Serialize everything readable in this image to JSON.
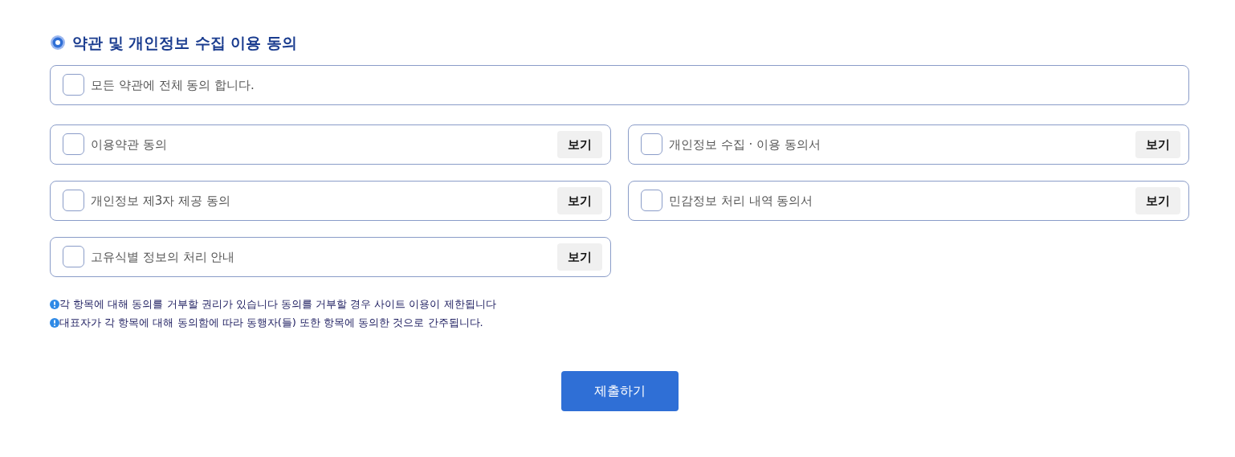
{
  "section": {
    "title": "약관 및 개인정보 수집 이용 동의"
  },
  "agree_all": {
    "label": "모든 약관에 전체 동의 합니다.",
    "checked": false
  },
  "terms": [
    {
      "label": "이용약관 동의",
      "checked": false,
      "view_button": "보기"
    },
    {
      "label": "개인정보 수집 · 이용 동의서",
      "checked": false,
      "view_button": "보기"
    },
    {
      "label": "개인정보 제3자 제공 동의",
      "checked": false,
      "view_button": "보기"
    },
    {
      "label": "민감정보 처리 내역 동의서",
      "checked": false,
      "view_button": "보기"
    },
    {
      "label": "고유식별 정보의 처리 안내",
      "checked": false,
      "view_button": "보기"
    }
  ],
  "notes": [
    "각 항목에 대해 동의를 거부할 권리가 있습니다 동의를 거부할 경우 사이트 이용이 제한됩니다",
    "대표자가 각 항목에 대해 동의함에 따라 동행자(들) 또한 항목에 동의한 것으로 간주됩니다."
  ],
  "submit_button": "제출하기"
}
